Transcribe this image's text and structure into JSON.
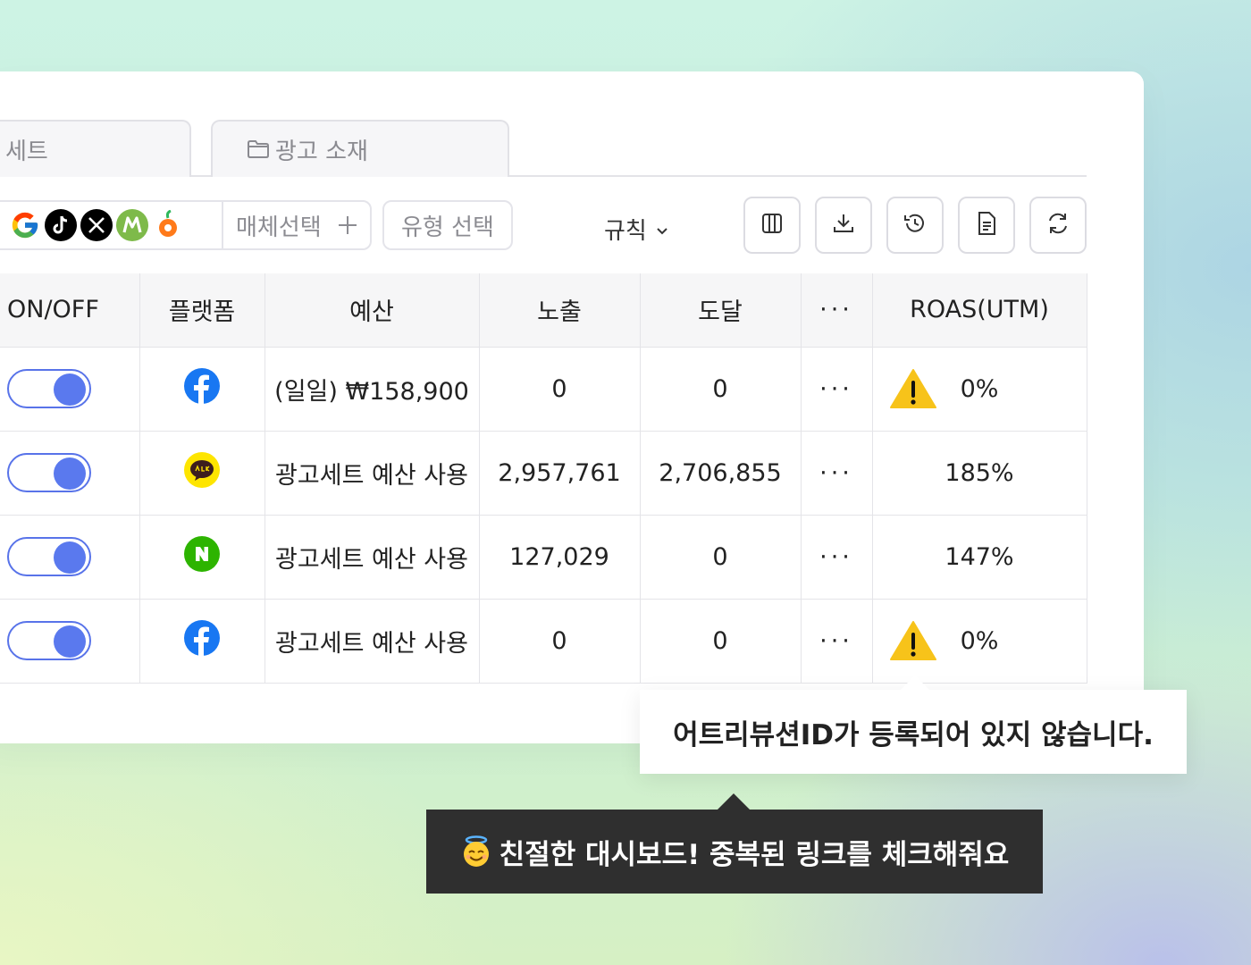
{
  "tabs": [
    {
      "label": "세트"
    },
    {
      "label": "광고 소재"
    }
  ],
  "filters": {
    "media_icons": [
      "google-icon",
      "tiktok-icon",
      "x-icon",
      "moloco-icon",
      "carrot-icon"
    ],
    "media_select_label": "매체선택",
    "type_select_label": "유형 선택",
    "rule_label": "규칙"
  },
  "toolbar": {
    "icons": [
      "columns-icon",
      "download-icon",
      "history-icon",
      "document-icon",
      "refresh-icon"
    ]
  },
  "table": {
    "headers": [
      "ON/OFF",
      "플랫폼",
      "예산",
      "노출",
      "도달",
      "···",
      "ROAS(UTM)"
    ],
    "rows": [
      {
        "on": true,
        "platform": "facebook-icon",
        "budget": "(일일) ₩158,900",
        "impressions": "0",
        "reach": "0",
        "more": "···",
        "roas": "0%",
        "warning": true
      },
      {
        "on": true,
        "platform": "kakaotalk-icon",
        "budget": "광고세트 예산 사용",
        "impressions": "2,957,761",
        "reach": "2,706,855",
        "more": "···",
        "roas": "185%",
        "warning": false
      },
      {
        "on": true,
        "platform": "naver-icon",
        "budget": "광고세트 예산 사용",
        "impressions": "127,029",
        "reach": "0",
        "more": "···",
        "roas": "147%",
        "warning": false
      },
      {
        "on": true,
        "platform": "facebook-icon",
        "budget": "광고세트 예산 사용",
        "impressions": "0",
        "reach": "0",
        "more": "···",
        "roas": "0%",
        "warning": true
      }
    ]
  },
  "tooltip_attribution": "어트리뷰션ID가 등록되어 있지 않습니다.",
  "tooltip_dashboard": "친절한 대시보드! 중복된 링크를 체크해줘요",
  "colors": {
    "toggle": "#5a79ee",
    "warning": "#f7c31a",
    "facebook": "#1877f2",
    "kakao": "#fee500",
    "naver": "#2db400"
  }
}
